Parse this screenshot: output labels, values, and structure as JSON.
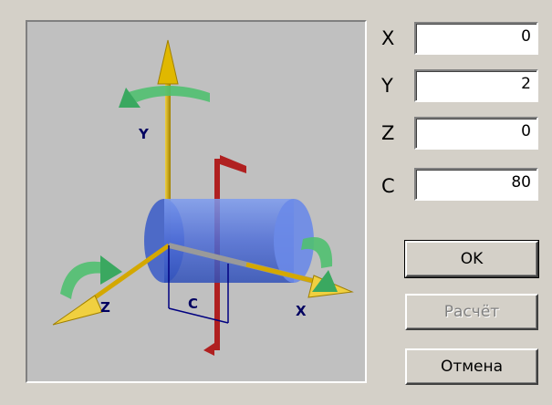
{
  "preview": {
    "axis_y_label": "Y",
    "axis_z_label": "Z",
    "axis_x_label": "X",
    "offset_label": "C"
  },
  "fields": [
    {
      "label": "X",
      "value": "0"
    },
    {
      "label": "Y",
      "value": "2"
    },
    {
      "label": "Z",
      "value": "0"
    },
    {
      "label": "C",
      "value": "80"
    }
  ],
  "buttons": {
    "ok": "OK",
    "calculate": "Расчёт",
    "cancel": "Отмена"
  },
  "colors": {
    "y_axis": "#d4a800",
    "red_axis": "#b02020",
    "cylinder": "#5a7be0",
    "rotation_arrow": "#4cc070"
  }
}
